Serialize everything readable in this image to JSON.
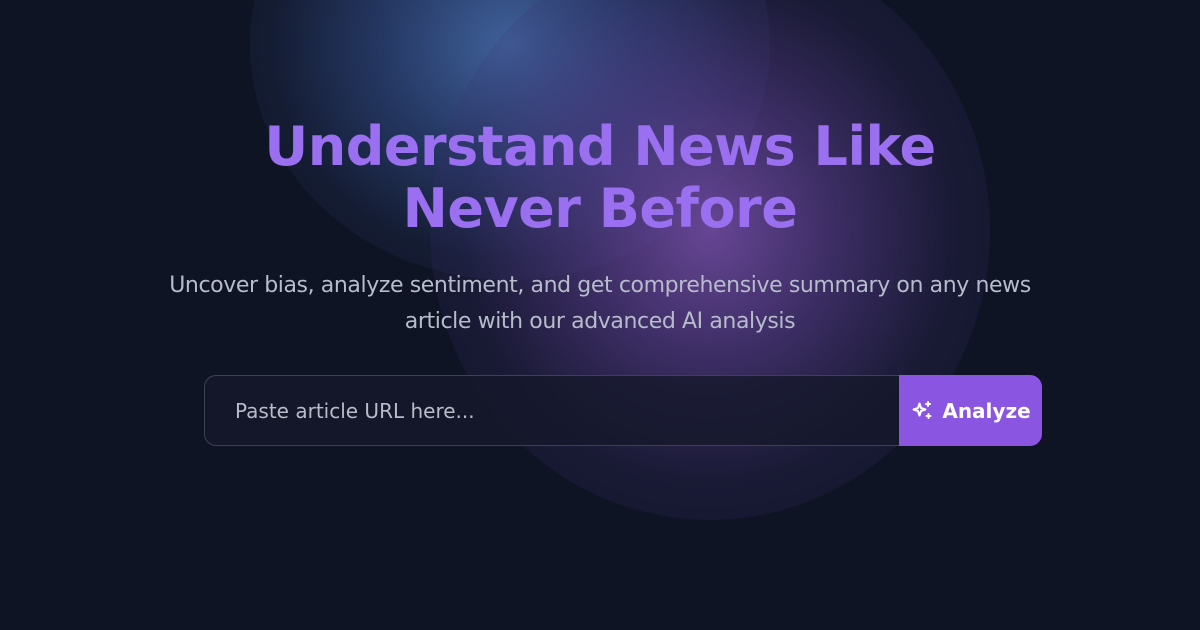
{
  "hero": {
    "title": "Understand News Like Never Before",
    "subtitle": "Uncover bias, analyze sentiment, and get comprehensive summary on any news article with our advanced AI analysis"
  },
  "search": {
    "placeholder": "Paste article URL here...",
    "value": "",
    "button_label": "Analyze",
    "button_icon": "sparkles-icon"
  },
  "colors": {
    "background": "#0f1424",
    "headline": "#9a6ff0",
    "subtitle": "#b6bccb",
    "button": "#8a55e0",
    "input_border": "#3a4254"
  }
}
